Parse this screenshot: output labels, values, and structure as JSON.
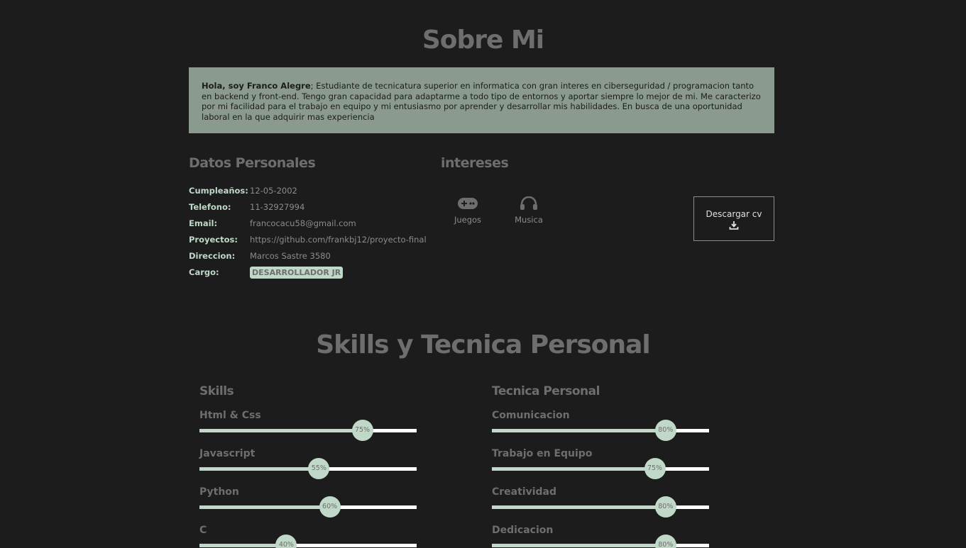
{
  "about": {
    "title": "Sobre Mi",
    "intro_name": "Hola, soy Franco Alegre",
    "intro_text": "; Estudiante de tecnicatura superior en informatica con gran interes en ciberseguridad / programacion tanto en backend y front-end. Tengo gran capacidad para adaptarme a todo tipo de entornos y aportar siempre lo mejor de mi. Me caracterizo por mi facilidad para el trabajo en equipo y mi entusiasmo por aprender y desarrollar mis habilidades. En busca de una oportunidad laboral en la que adquirir mas experiencia"
  },
  "personal": {
    "title": "Datos Personales",
    "rows": [
      {
        "label": "Cumpleaños:",
        "value": "12-05-2002"
      },
      {
        "label": "Telefono:",
        "value": "11-32927994"
      },
      {
        "label": "Email:",
        "value": "francocacu58@gmail.com"
      },
      {
        "label": "Proyectos:",
        "value": "https://github.com/frankbj12/proyecto-final"
      },
      {
        "label": "Direccion:",
        "value": "Marcos Sastre 3580"
      },
      {
        "label": "Cargo:",
        "value": "DESARROLLADOR JR"
      }
    ]
  },
  "interests": {
    "title": "intereses",
    "items": [
      {
        "label": "Juegos",
        "icon": "gamepad-icon"
      },
      {
        "label": "Musica",
        "icon": "headphones-icon"
      }
    ]
  },
  "cv_button": {
    "label": "Descargar cv",
    "icon": "download-icon"
  },
  "skills_section": {
    "title": "Skills y Tecnica Personal",
    "skills": {
      "title": "Skills",
      "items": [
        {
          "label": "Html & Css",
          "value": 75,
          "text": "75%"
        },
        {
          "label": "Javascript",
          "value": 55,
          "text": "55%"
        },
        {
          "label": "Python",
          "value": 60,
          "text": "60%"
        },
        {
          "label": "C",
          "value": 40,
          "text": "40%"
        }
      ]
    },
    "personal": {
      "title": "Tecnica Personal",
      "items": [
        {
          "label": "Comunicacion",
          "value": 80,
          "text": "80%"
        },
        {
          "label": "Trabajo en Equipo",
          "value": 75,
          "text": "75%"
        },
        {
          "label": "Creatividad",
          "value": 80,
          "text": "80%"
        },
        {
          "label": "Dedicacion",
          "value": 80,
          "text": "80%"
        }
      ]
    }
  },
  "colors": {
    "background": "#1c1c1d",
    "accent": "#bfd8c7",
    "intro_box": "#8a9a8e",
    "heading": "#6e6e6e",
    "muted_text": "#8c8c8c"
  }
}
